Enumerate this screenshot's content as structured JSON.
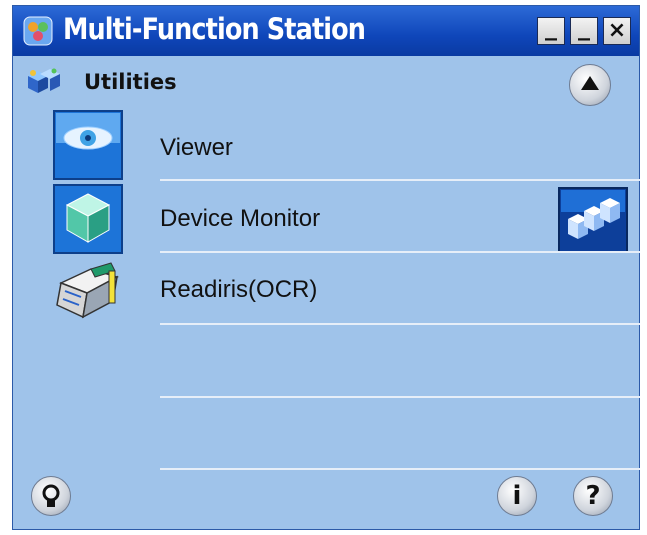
{
  "window": {
    "title": "Multi-Function Station",
    "buttons": {
      "close_glyph": "×"
    }
  },
  "section": {
    "title": "Utilities"
  },
  "items": [
    {
      "label": "Viewer",
      "icon": "eye-icon"
    },
    {
      "label": "Device Monitor",
      "icon": "cube-icon"
    },
    {
      "label": "Readiris(OCR)",
      "icon": "ocr-scanner-icon"
    }
  ],
  "footer": {
    "info_label": "i",
    "help_label": "?"
  },
  "colors": {
    "titlebar": "#1453c8",
    "panel": "#9fc3ea",
    "divider": "#e6eef8"
  }
}
